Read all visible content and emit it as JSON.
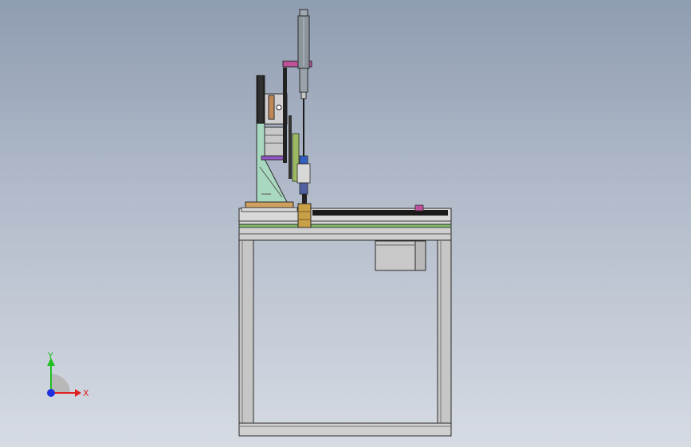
{
  "viewport": {
    "background_top": "#8f9db1",
    "background_bottom": "#d6dbe3"
  },
  "triad": {
    "x_label": "X",
    "y_label": "Y",
    "x_color": "#e02020",
    "y_color": "#20c020",
    "z_color": "#2030e0"
  },
  "model": {
    "frame_color": "#c9c9c9",
    "frame_edge": "#2a2a2a",
    "motor_color": "#c8c8c8",
    "rail_color": "#1a1a1a",
    "green_rail_color": "#7fb86b",
    "magenta_color": "#c0509a",
    "purple_color": "#9055c0",
    "mint_color": "#a8d8c0",
    "olive_color": "#9cb860",
    "orange_color": "#d0a060",
    "cylinder_color": "#9098a0",
    "gold_color": "#c8a048",
    "blue_color": "#3060c0"
  }
}
